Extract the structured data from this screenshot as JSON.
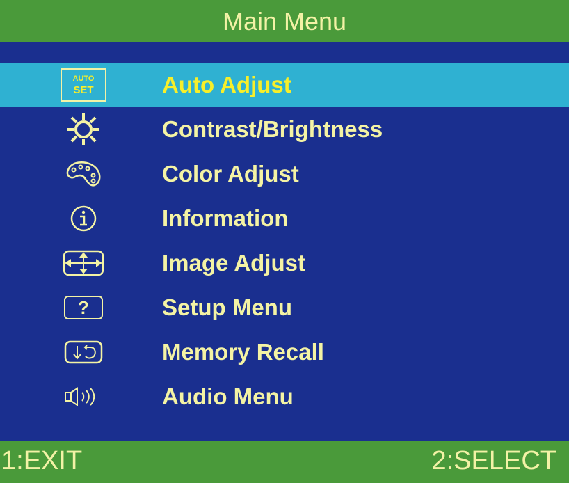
{
  "header": {
    "title": "Main Menu"
  },
  "menu": {
    "items": [
      {
        "label": "Auto Adjust",
        "icon": "auto-set-icon",
        "icon_text_top": "AUTO",
        "icon_text_bottom": "SET",
        "selected": true
      },
      {
        "label": "Contrast/Brightness",
        "icon": "sun-icon"
      },
      {
        "label": "Color Adjust",
        "icon": "palette-icon"
      },
      {
        "label": "Information",
        "icon": "info-icon"
      },
      {
        "label": "Image Adjust",
        "icon": "move-arrows-icon"
      },
      {
        "label": "Setup Menu",
        "icon": "question-icon",
        "icon_text": "?"
      },
      {
        "label": "Memory Recall",
        "icon": "recall-icon"
      },
      {
        "label": "Audio Menu",
        "icon": "speaker-icon"
      }
    ]
  },
  "footer": {
    "exit_label": "1:EXIT",
    "select_label": "2:SELECT"
  },
  "colors": {
    "background": "#1a2f8f",
    "header_footer": "#4a9a3a",
    "selected_row": "#2fb1d2",
    "text": "#f4f3a4",
    "selected_text": "#f7ef2a"
  }
}
